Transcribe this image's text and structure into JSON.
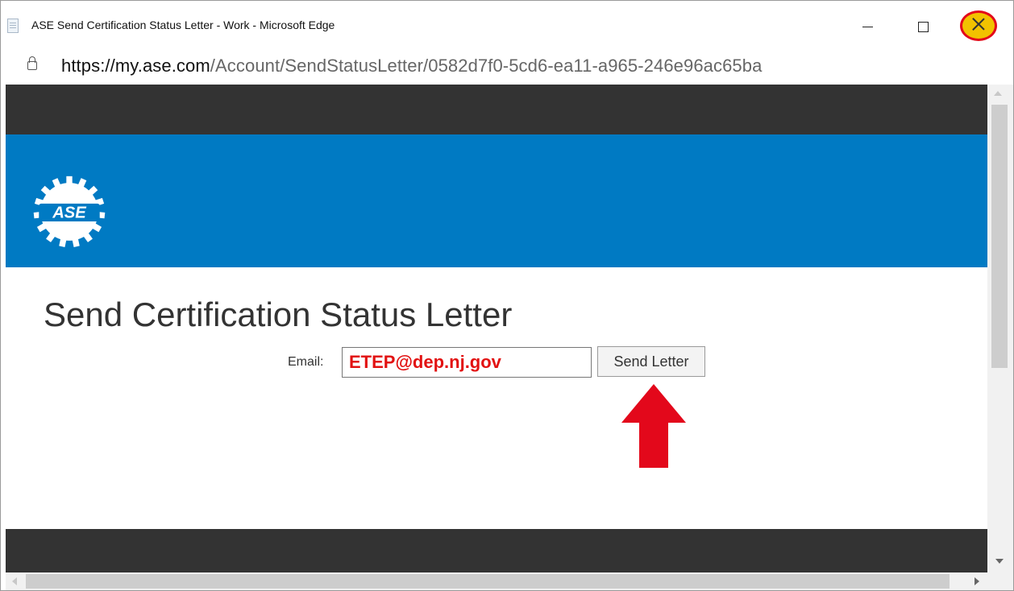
{
  "browser": {
    "window_title": "ASE Send Certification Status Letter - Work - Microsoft Edge",
    "url_domain": "https://my.ase.com",
    "url_path": "/Account/SendStatusLetter/0582d7f0-5cd6-ea11-a965-246e96ac65ba"
  },
  "page": {
    "logo_text": "ASE",
    "title": "Send Certification Status Letter",
    "email_label": "Email:",
    "email_value": "ETEP@dep.nj.gov",
    "send_button_label": "Send Letter"
  },
  "colors": {
    "header_dark": "#333333",
    "brand_blue": "#007ac3",
    "annotation_red": "#e3081b",
    "close_highlight_yellow": "#f2c200",
    "email_text_red": "#e21212"
  },
  "icons": {
    "page": "page-icon",
    "lock": "lock-icon",
    "minimize": "minimize-icon",
    "maximize": "maximize-icon",
    "close": "close-icon",
    "annotation_arrow": "red-arrow-up"
  }
}
